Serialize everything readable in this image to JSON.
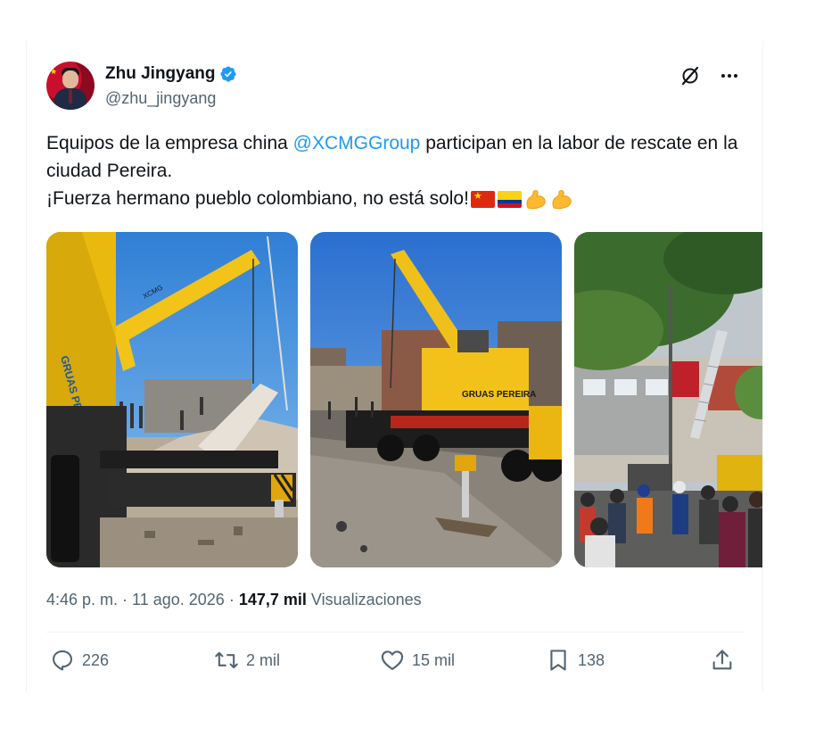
{
  "author": {
    "display_name": "Zhu Jingyang",
    "handle": "@zhu_jingyang",
    "verified": true
  },
  "tweet": {
    "text_part1": "Equipos de la empresa china ",
    "mention": "@XCMGGroup",
    "text_part2": " participan en la labor de rescate en la ciudad Pereira.",
    "line2": "¡Fuerza hermano pueblo colombiano, no está solo!",
    "emojis": [
      "flag-china-icon",
      "flag-colombia-icon",
      "flexed-biceps-icon",
      "flexed-biceps-icon"
    ]
  },
  "media": {
    "photos": [
      {
        "name": "photo-crane-rubble"
      },
      {
        "name": "photo-crane-street"
      },
      {
        "name": "photo-rescue-crowd"
      }
    ],
    "crane_text": "GRUAS PEREIRA",
    "crane_brand": "XCMG"
  },
  "meta": {
    "time": "4:46 p. m.",
    "separator": " · ",
    "date": "11 ago. 2026",
    "views_count": "147,7 mil",
    "views_label": "Visualizaciones"
  },
  "actions": {
    "replies": "226",
    "reposts": "2 mil",
    "likes": "15 mil",
    "bookmarks": "138"
  },
  "colors": {
    "accent": "#1d9bf0",
    "text_secondary": "#536471",
    "text_primary": "#0f1419"
  }
}
